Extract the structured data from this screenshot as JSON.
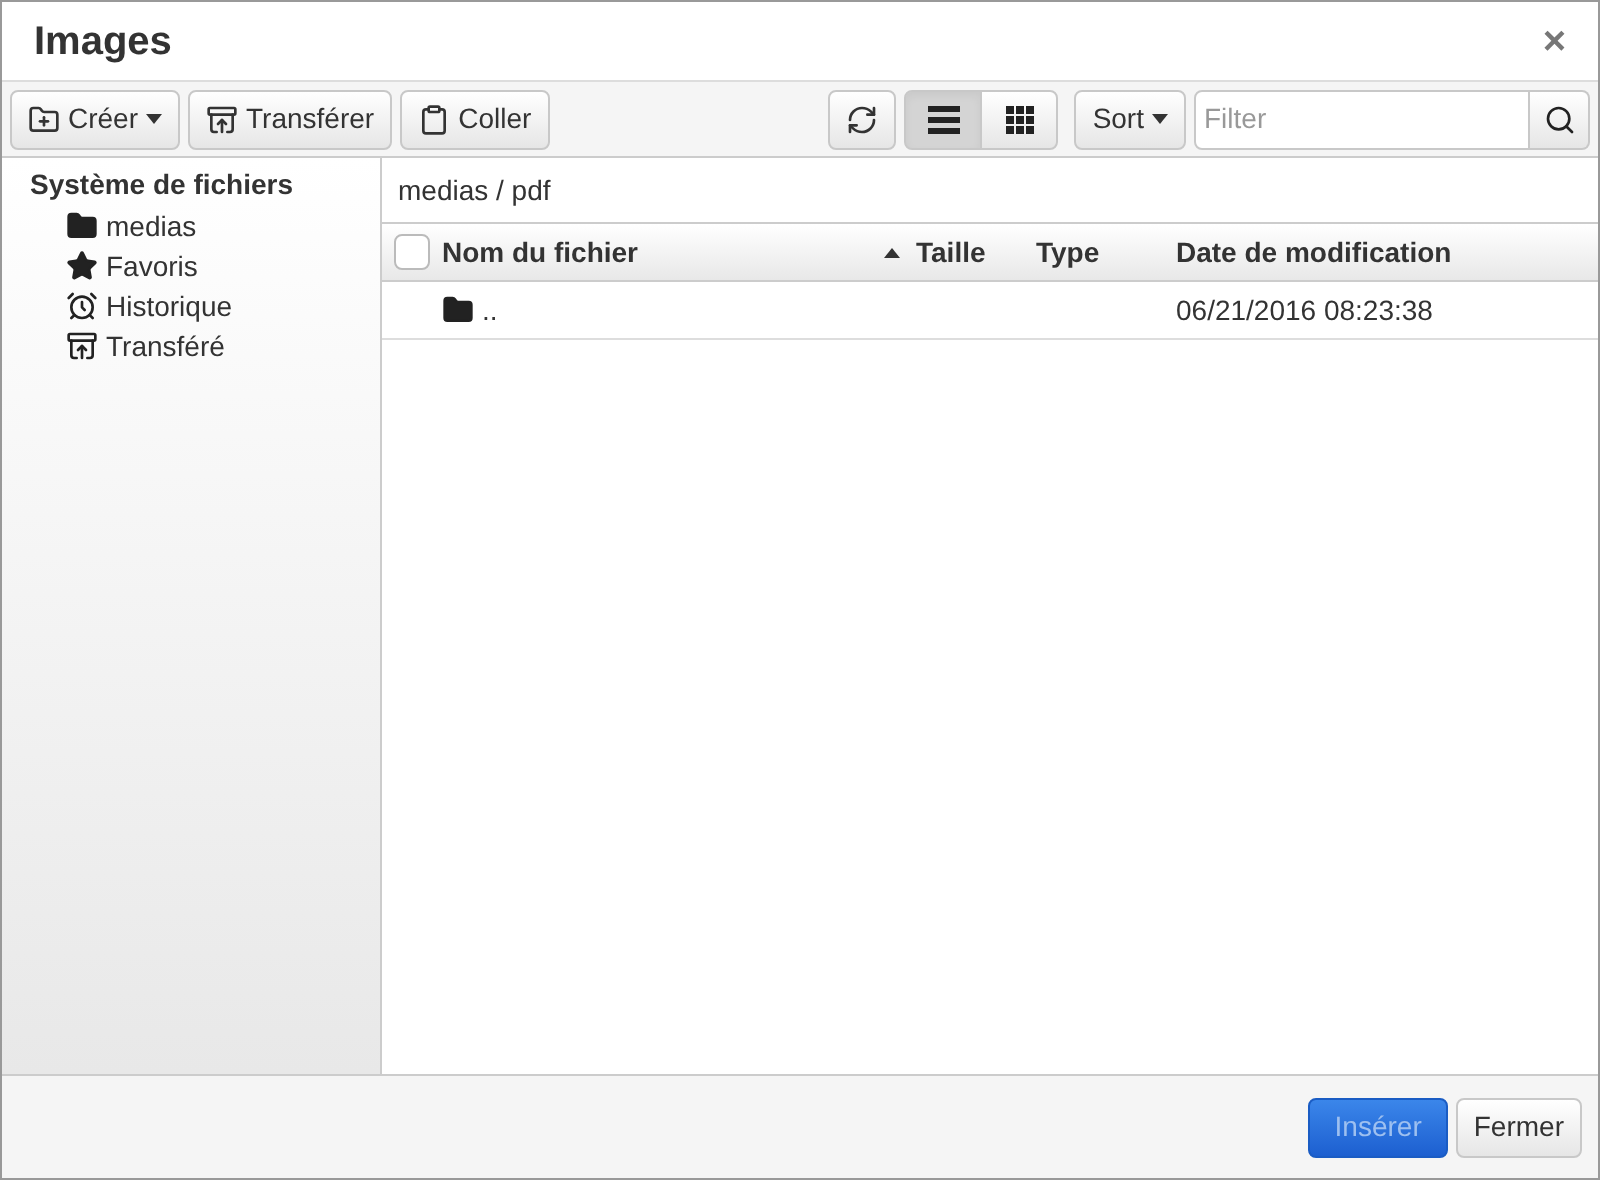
{
  "window": {
    "title": "Images",
    "close": "×"
  },
  "toolbar": {
    "create": "Créer",
    "upload": "Transférer",
    "paste": "Coller",
    "views": [
      {
        "kind": "list",
        "selected": true
      },
      {
        "kind": "grid",
        "selected": false
      }
    ],
    "sort": "Sort",
    "filter": {
      "placeholder": "Filter"
    }
  },
  "sidebar": {
    "title": "Système de fichiers",
    "items": [
      {
        "kind": "folder",
        "label": "medias"
      },
      {
        "kind": "star",
        "label": "Favoris"
      },
      {
        "kind": "alarm",
        "label": "Historique"
      },
      {
        "kind": "upload",
        "label": "Transféré"
      }
    ]
  },
  "breadcrumb": "medias / pdf",
  "table": {
    "select_all": {
      "checked": false
    },
    "columns": [
      {
        "label": "Nom du fichier",
        "sorted": true
      },
      {
        "label": "Taille",
        "sorted": false
      },
      {
        "label": "Type",
        "sorted": false
      },
      {
        "label": "Date de modification",
        "sorted": false
      }
    ],
    "rows": [
      {
        "name": "..",
        "size": "",
        "type": "",
        "date": "06/21/2016 08:23:38"
      }
    ]
  },
  "footer": {
    "insert": {
      "label": "Insérer",
      "disabled": true
    },
    "close": "Fermer"
  }
}
